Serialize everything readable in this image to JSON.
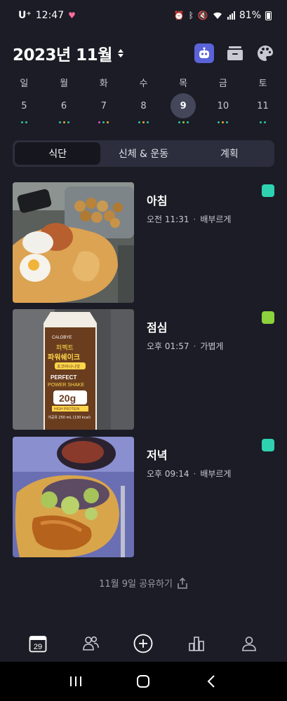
{
  "status_bar": {
    "carrier": "U⁺",
    "time": "12:47",
    "battery": "81%"
  },
  "header": {
    "title": "2023년 11월"
  },
  "weekdays": [
    "일",
    "월",
    "화",
    "수",
    "목",
    "금",
    "토"
  ],
  "days": [
    {
      "num": "5",
      "selected": false,
      "dots": [
        "#2ec4a6",
        "#2ec4a6"
      ]
    },
    {
      "num": "6",
      "selected": false,
      "dots": [
        "#2ec4a6",
        "#f0a830",
        "#2ec4a6"
      ]
    },
    {
      "num": "7",
      "selected": false,
      "dots": [
        "#d94fd0",
        "#2ec4a6",
        "#f0a830"
      ]
    },
    {
      "num": "8",
      "selected": false,
      "dots": [
        "#2ec4a6",
        "#f0a830",
        "#2ec4a6"
      ]
    },
    {
      "num": "9",
      "selected": true,
      "dots": [
        "#2ec4a6",
        "#8cd23c",
        "#2ec4a6"
      ]
    },
    {
      "num": "10",
      "selected": false,
      "dots": [
        "#2ec4a6",
        "#f0a830",
        "#2ec4a6"
      ]
    },
    {
      "num": "11",
      "selected": false,
      "dots": [
        "#2ec4a6",
        "#2ec4a6"
      ]
    }
  ],
  "tabs": [
    "식단",
    "신체 & 운동",
    "계획"
  ],
  "meals": [
    {
      "name": "아침",
      "time": "오전 11:31",
      "fullness": "배부르게",
      "tag_color": "#2ed2b0"
    },
    {
      "name": "점심",
      "time": "오후 01:57",
      "fullness": "가볍게",
      "tag_color": "#8cd23c"
    },
    {
      "name": "저녁",
      "time": "오후 09:14",
      "fullness": "배부르게",
      "tag_color": "#2ed2b0"
    }
  ],
  "shake": {
    "brand": "CALOBYE",
    "line1": "퍼펙트",
    "line2": "파워쉐이크",
    "flavor": "초코바나나맛",
    "en1": "PERFECT",
    "en2": "POWER SHAKE",
    "protein": "20g",
    "protein_label": "HIGH PROTEIN",
    "spec": "가공유 250 mL (130 kcal)"
  },
  "share": {
    "label": "11월 9일 공유하기"
  },
  "nav": {
    "calendar_day": "29"
  },
  "colors": {
    "background": "#1b1c25",
    "tab_bar": "#2c2e3d",
    "accent": "#5a63d8"
  }
}
